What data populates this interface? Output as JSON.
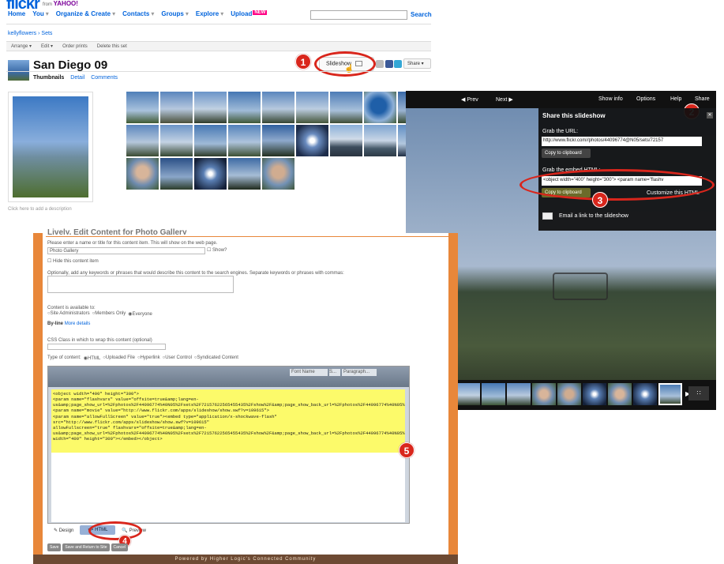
{
  "flickr": {
    "logo": "flickr",
    "logo_from": "from",
    "logo_yahoo": "YAHOO!",
    "nav": [
      {
        "label": "Home"
      },
      {
        "label": "You"
      },
      {
        "label": "Organize & Create"
      },
      {
        "label": "Contacts"
      },
      {
        "label": "Groups"
      },
      {
        "label": "Explore"
      },
      {
        "label": "Upload"
      }
    ],
    "new_badge": "NEW",
    "search_label": "Search",
    "breadcrumb": "kellyflowers › Sets",
    "toolbar": [
      "Arrange",
      "Edit",
      "Order prints",
      "Delete this set"
    ],
    "set_title": "San Diego 09",
    "subtabs": {
      "thumbnails": "Thumbnails",
      "detail": "Detail",
      "comments": "Comments"
    },
    "slideshow_label": "Slideshow",
    "share_label": "Share",
    "description_hint": "Click here to add a description"
  },
  "slideshow": {
    "prev": "◀ Prev",
    "next": "Next ▶",
    "show_info": "Show info",
    "options": "Options",
    "help": "Help",
    "share": "Share",
    "panel_title": "Share this slideshow",
    "grab_url_label": "Grab the URL:",
    "url_value": "http://www.flickr.com//photos/44096774@N05/sets/72157",
    "copy_label": "Copy to clipboard",
    "grab_embed_label": "Grab the embed HTML:",
    "embed_value": "<object width=\"400\" height=\"300\"> <param name=\"flashv",
    "copy_label_2": "Copy to clipboard",
    "customize_label": "Customize this HTML",
    "email_label": "Email a link to the slideshow"
  },
  "cms": {
    "heading": "Lively, Edit Content for Photo Gallery",
    "name_prompt": "Please enter a name or title for this content item. This will show on the web page.",
    "name_value": "Photo Gallery",
    "show_label": "Show?",
    "hide_label": "Hide this content item",
    "keywords_prompt": "Optionally, add any keywords or phrases that would describe this content to the search engines. Separate keywords or phrases with commas:",
    "available_to": "Content is available to:",
    "availability": [
      "Site Administrators",
      "Members Only",
      "Everyone"
    ],
    "byline_label": "By-line",
    "byline_link": "More details",
    "css_label": "CSS Class in which to wrap this content (optional)",
    "type_label": "Type of content:",
    "types": [
      "HTML",
      "Uploaded File",
      "Hyperlink",
      "User Control",
      "Syndicated Content"
    ],
    "font_name": "Font Name",
    "size": "S...",
    "paragraph": "Paragraph...",
    "code": "<object width=\"400\" height=\"300\">\n<param name=\"flashvars\" value=\"offsite=true&amp;lang=en-us&amp;page_show_url=%2Fphotos%2F44096774%40N05%2Fsets%2F72157622565455435%2Fshow%2F&amp;page_show_back_url=%2Fphotos%2F44096774%40N05%2Fsets%2F72157622565455435%2F&amp;set_id=72157622565455435&amp;jump_to=\">\n<param name=\"movie\" value=\"http://www.flickr.com/apps/slideshow/show.swf?v=109615\">\n<param name=\"allowFullScreen\" value=\"true\"><embed type=\"application/x-shockwave-flash\" src=\"http://www.flickr.com/apps/slideshow/show.swf?v=109615\"\nallowFullscreen=\"true\" flashvars=\"offsite=true&amp;lang=en-\nus&amp;page_show_url=%2Fphotos%2F44096774%40N05%2Fsets%2F72157622565455435%2Fshow%2F&amp;page_show_back_url=%2Fphotos%2F44096774%40N05%2Fsets%2F72157622565455435%2F&amp;set_id=72157622565455435&amp;jump_to=\" width=\"400\" height=\"300\"></embed></object>",
    "tab_design": "Design",
    "tab_html": "HTML",
    "tab_preview": "Preview",
    "buttons": [
      "Save",
      "Save and Return to Site",
      "Cancel"
    ],
    "footer": "Powered by Higher Logic's Connected Community"
  },
  "badges": [
    "1",
    "2",
    "3",
    "4",
    "5"
  ],
  "colors": {
    "callout": "#d9261c",
    "flickr_blue": "#0063dc",
    "highlight": "#fcfa6a",
    "cms_border": "#e8873a"
  }
}
